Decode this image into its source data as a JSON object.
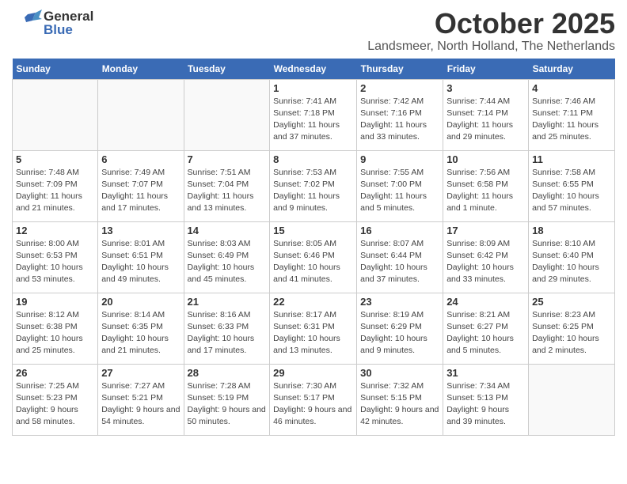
{
  "header": {
    "logo_general": "General",
    "logo_blue": "Blue",
    "month_title": "October 2025",
    "location": "Landsmeer, North Holland, The Netherlands"
  },
  "days_of_week": [
    "Sunday",
    "Monday",
    "Tuesday",
    "Wednesday",
    "Thursday",
    "Friday",
    "Saturday"
  ],
  "weeks": [
    {
      "days": [
        {
          "date": "",
          "info": ""
        },
        {
          "date": "",
          "info": ""
        },
        {
          "date": "",
          "info": ""
        },
        {
          "date": "1",
          "info": "Sunrise: 7:41 AM\nSunset: 7:18 PM\nDaylight: 11 hours and 37 minutes."
        },
        {
          "date": "2",
          "info": "Sunrise: 7:42 AM\nSunset: 7:16 PM\nDaylight: 11 hours and 33 minutes."
        },
        {
          "date": "3",
          "info": "Sunrise: 7:44 AM\nSunset: 7:14 PM\nDaylight: 11 hours and 29 minutes."
        },
        {
          "date": "4",
          "info": "Sunrise: 7:46 AM\nSunset: 7:11 PM\nDaylight: 11 hours and 25 minutes."
        }
      ]
    },
    {
      "days": [
        {
          "date": "5",
          "info": "Sunrise: 7:48 AM\nSunset: 7:09 PM\nDaylight: 11 hours and 21 minutes."
        },
        {
          "date": "6",
          "info": "Sunrise: 7:49 AM\nSunset: 7:07 PM\nDaylight: 11 hours and 17 minutes."
        },
        {
          "date": "7",
          "info": "Sunrise: 7:51 AM\nSunset: 7:04 PM\nDaylight: 11 hours and 13 minutes."
        },
        {
          "date": "8",
          "info": "Sunrise: 7:53 AM\nSunset: 7:02 PM\nDaylight: 11 hours and 9 minutes."
        },
        {
          "date": "9",
          "info": "Sunrise: 7:55 AM\nSunset: 7:00 PM\nDaylight: 11 hours and 5 minutes."
        },
        {
          "date": "10",
          "info": "Sunrise: 7:56 AM\nSunset: 6:58 PM\nDaylight: 11 hours and 1 minute."
        },
        {
          "date": "11",
          "info": "Sunrise: 7:58 AM\nSunset: 6:55 PM\nDaylight: 10 hours and 57 minutes."
        }
      ]
    },
    {
      "days": [
        {
          "date": "12",
          "info": "Sunrise: 8:00 AM\nSunset: 6:53 PM\nDaylight: 10 hours and 53 minutes."
        },
        {
          "date": "13",
          "info": "Sunrise: 8:01 AM\nSunset: 6:51 PM\nDaylight: 10 hours and 49 minutes."
        },
        {
          "date": "14",
          "info": "Sunrise: 8:03 AM\nSunset: 6:49 PM\nDaylight: 10 hours and 45 minutes."
        },
        {
          "date": "15",
          "info": "Sunrise: 8:05 AM\nSunset: 6:46 PM\nDaylight: 10 hours and 41 minutes."
        },
        {
          "date": "16",
          "info": "Sunrise: 8:07 AM\nSunset: 6:44 PM\nDaylight: 10 hours and 37 minutes."
        },
        {
          "date": "17",
          "info": "Sunrise: 8:09 AM\nSunset: 6:42 PM\nDaylight: 10 hours and 33 minutes."
        },
        {
          "date": "18",
          "info": "Sunrise: 8:10 AM\nSunset: 6:40 PM\nDaylight: 10 hours and 29 minutes."
        }
      ]
    },
    {
      "days": [
        {
          "date": "19",
          "info": "Sunrise: 8:12 AM\nSunset: 6:38 PM\nDaylight: 10 hours and 25 minutes."
        },
        {
          "date": "20",
          "info": "Sunrise: 8:14 AM\nSunset: 6:35 PM\nDaylight: 10 hours and 21 minutes."
        },
        {
          "date": "21",
          "info": "Sunrise: 8:16 AM\nSunset: 6:33 PM\nDaylight: 10 hours and 17 minutes."
        },
        {
          "date": "22",
          "info": "Sunrise: 8:17 AM\nSunset: 6:31 PM\nDaylight: 10 hours and 13 minutes."
        },
        {
          "date": "23",
          "info": "Sunrise: 8:19 AM\nSunset: 6:29 PM\nDaylight: 10 hours and 9 minutes."
        },
        {
          "date": "24",
          "info": "Sunrise: 8:21 AM\nSunset: 6:27 PM\nDaylight: 10 hours and 5 minutes."
        },
        {
          "date": "25",
          "info": "Sunrise: 8:23 AM\nSunset: 6:25 PM\nDaylight: 10 hours and 2 minutes."
        }
      ]
    },
    {
      "days": [
        {
          "date": "26",
          "info": "Sunrise: 7:25 AM\nSunset: 5:23 PM\nDaylight: 9 hours and 58 minutes."
        },
        {
          "date": "27",
          "info": "Sunrise: 7:27 AM\nSunset: 5:21 PM\nDaylight: 9 hours and 54 minutes."
        },
        {
          "date": "28",
          "info": "Sunrise: 7:28 AM\nSunset: 5:19 PM\nDaylight: 9 hours and 50 minutes."
        },
        {
          "date": "29",
          "info": "Sunrise: 7:30 AM\nSunset: 5:17 PM\nDaylight: 9 hours and 46 minutes."
        },
        {
          "date": "30",
          "info": "Sunrise: 7:32 AM\nSunset: 5:15 PM\nDaylight: 9 hours and 42 minutes."
        },
        {
          "date": "31",
          "info": "Sunrise: 7:34 AM\nSunset: 5:13 PM\nDaylight: 9 hours and 39 minutes."
        },
        {
          "date": "",
          "info": ""
        }
      ]
    }
  ]
}
